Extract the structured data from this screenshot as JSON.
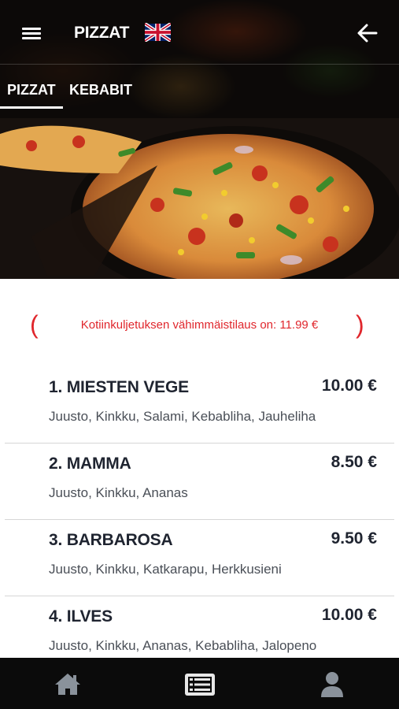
{
  "header": {
    "title": "PIZZAT",
    "menu_icon": "hamburger-menu-icon",
    "language_icon": "uk-flag-icon",
    "back_icon": "arrow-left-icon"
  },
  "tabs": [
    {
      "label": "PIZZAT",
      "active": true
    },
    {
      "label": "KEBABIT",
      "active": false
    }
  ],
  "notice": {
    "text": "Kotiinkuljetuksen vähimmäistilaus on: 11.99 €",
    "color": "#e0262c"
  },
  "menu_items": [
    {
      "name": "1. MIESTEN VEGE",
      "price": "10.00 €",
      "description": "Juusto, Kinkku, Salami, Kebabliha, Jauheliha"
    },
    {
      "name": "2. MAMMA",
      "price": "8.50 €",
      "description": "Juusto, Kinkku, Ananas"
    },
    {
      "name": "3. BARBAROSA",
      "price": "9.50 €",
      "description": "Juusto, Kinkku, Katkarapu, Herkkusieni"
    },
    {
      "name": "4. ILVES",
      "price": "10.00 €",
      "description": "Juusto, Kinkku, Ananas, Kebabliha, Jalopeno"
    }
  ],
  "bottom_nav": [
    {
      "icon": "home-icon"
    },
    {
      "icon": "menu-list-icon",
      "active": true
    },
    {
      "icon": "user-icon"
    }
  ],
  "colors": {
    "header_bg": "#1b1512",
    "text_dark": "#1f2430",
    "nav_bg": "#0b0b0b",
    "nav_icon": "#8a929b"
  }
}
